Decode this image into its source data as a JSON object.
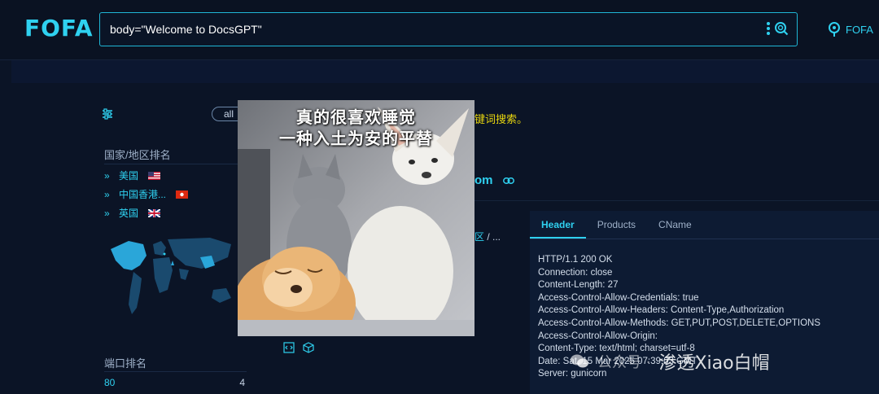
{
  "header": {
    "logo": "FOFA",
    "search_value": "body=\"Welcome to DocsGPT\"",
    "brand_right": "FOFA"
  },
  "filters": {
    "all_label": "all",
    "hint_text": "键词搜索。"
  },
  "country_section": {
    "title": "国家/地区排名",
    "items": [
      {
        "label": "美国",
        "flag": "us-flag"
      },
      {
        "label": "中国香港...",
        "flag": "hk-flag"
      },
      {
        "label": "英国",
        "flag": "uk-flag"
      }
    ]
  },
  "port_section": {
    "title": "端口排名",
    "items": [
      {
        "port": "80",
        "count": "4"
      }
    ]
  },
  "result": {
    "host_fragment": "om",
    "location_link": "区",
    "location_rest": " / ..."
  },
  "detail": {
    "tabs": [
      "Header",
      "Products",
      "CName"
    ],
    "active_tab": "Header",
    "header_lines": [
      "HTTP/1.1 200 OK",
      "Connection: close",
      "Content-Length: 27",
      "Access-Control-Allow-Credentials: true",
      "Access-Control-Allow-Headers: Content-Type,Authorization",
      "Access-Control-Allow-Methods: GET,PUT,POST,DELETE,OPTIONS",
      "Access-Control-Allow-Origin: ",
      "Content-Type: text/html; charset=utf-8",
      "Date: Sat, 15 Mar 2025 07:39:03 GMT",
      "Server: gunicorn"
    ]
  },
  "overlay": {
    "caption_line1": "真的很喜欢睡觉",
    "caption_line2": "一种入土为安的平替"
  },
  "watermark": {
    "prefix": "公众号 ·",
    "name": "渗透Xiao白帽"
  },
  "colors": {
    "accent": "#2fd1f0",
    "background": "#0b1426",
    "hint": "#e8d60f"
  }
}
